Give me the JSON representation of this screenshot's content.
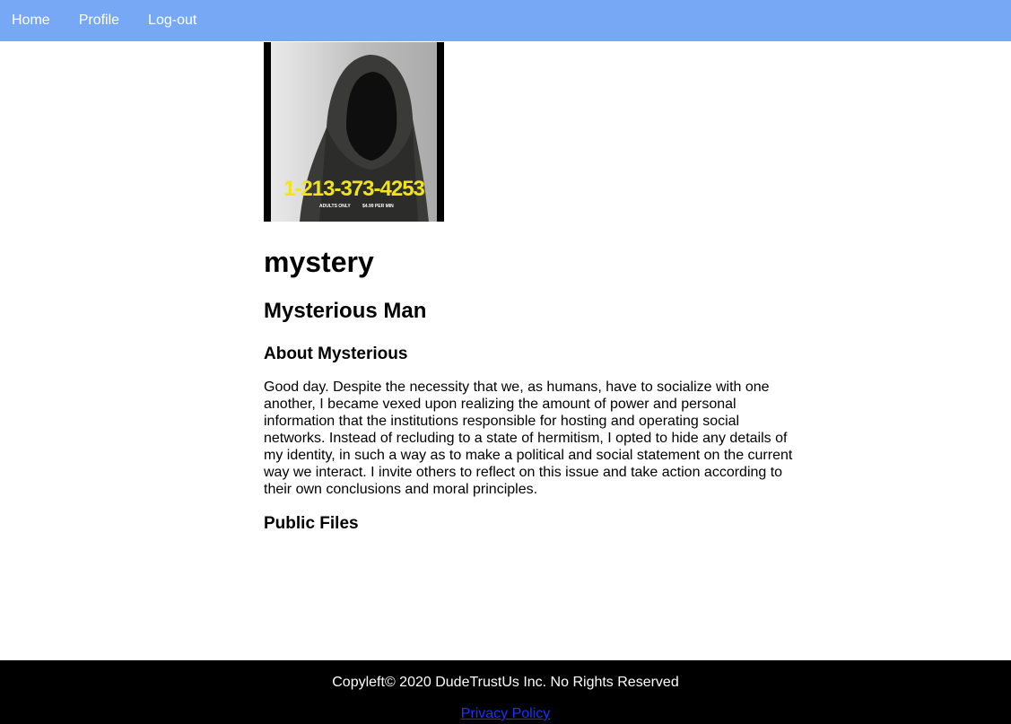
{
  "nav": {
    "items": [
      {
        "label": "Home"
      },
      {
        "label": "Profile"
      },
      {
        "label": "Log-out"
      }
    ]
  },
  "profile": {
    "photo": {
      "phone_text": "1-213-373-4253",
      "small_left": "ADULTS ONLY",
      "small_right": "$4.99 PER MIN"
    },
    "username": "mystery",
    "full_name": "Mysterious Man",
    "about_heading": "About Mysterious",
    "about_text": "Good day. Despite the necessity that we, as humans, have to socialize with one another, I became vexed upon realizing the amount of power and personal information that the institutions responsible for hosting and operating social networks. Instead of recluding to a state of hermitism, I opted to hide any details of my identity, in such a way as to make a political and social statement on the current way we interact. I invite others to reflect on this issue and take action according to their own conclusions and moral principles.",
    "files_heading": "Public Files"
  },
  "footer": {
    "copyright": "Copyleft© 2020 DudeTrustUs Inc. No Rights Reserved",
    "privacy_label": "Privacy Policy"
  },
  "colors": {
    "navbar": "#76a8f5",
    "footer": "#000000",
    "link": "#1a33ff"
  }
}
